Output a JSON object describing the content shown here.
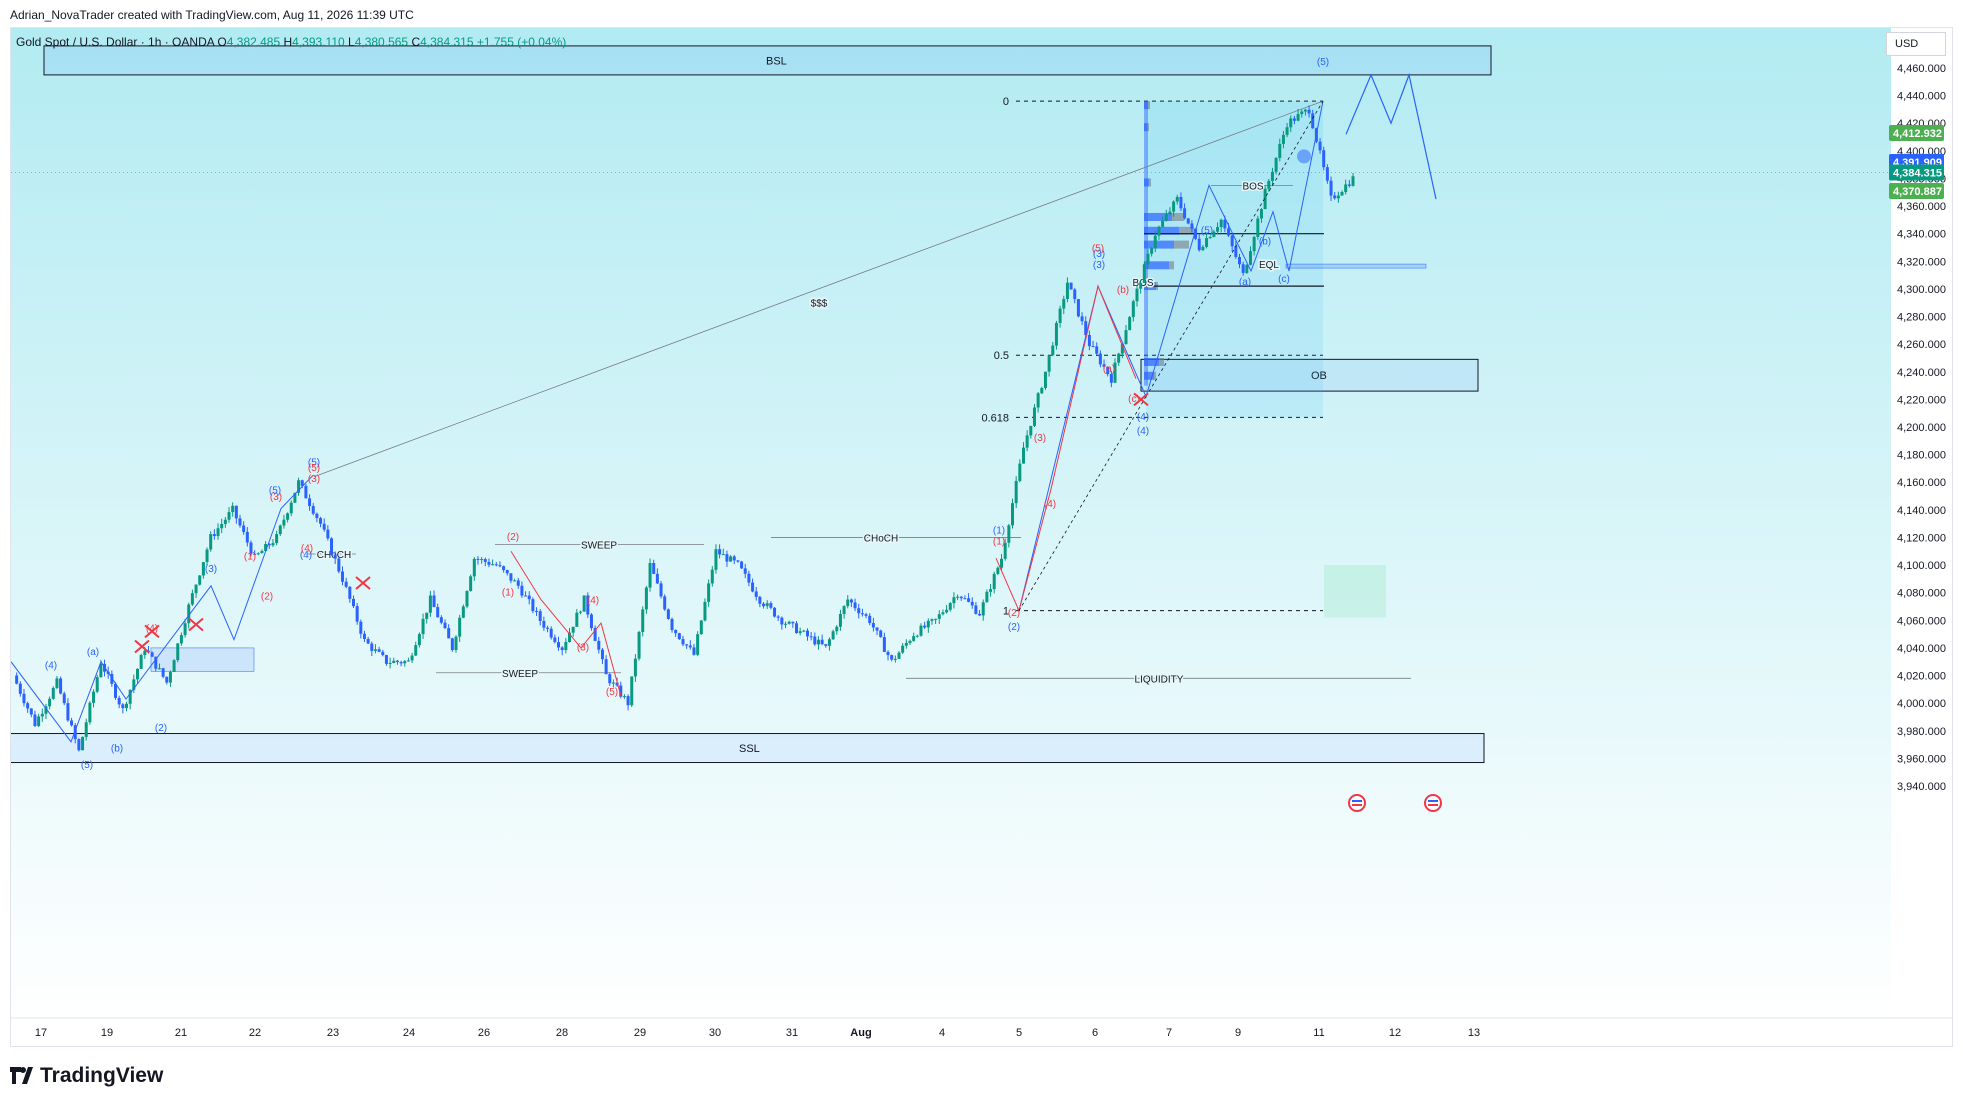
{
  "header": {
    "attribution": "Adrian_NovaTrader created with TradingView.com, Aug 11, 2026 11:39 UTC"
  },
  "symbol": {
    "name": "Gold Spot / U.S. Dollar · 1h · OANDA",
    "o_label": "O",
    "o": "4,382.485",
    "h_label": "H",
    "h": "4,393.110",
    "l_label": "L",
    "l": "4,380.565",
    "c_label": "C",
    "c": "4,384.315",
    "change": "+1.755 (+0.04%)"
  },
  "currency": "USD",
  "footer": {
    "brand": "TradingView"
  },
  "colors": {
    "up": "#089981",
    "down": "#2962ff",
    "blue_wave": "#2962ff",
    "red_wave": "#f23645",
    "bg_top": "#b2ebf2",
    "bg_bottom": "#ffffff"
  },
  "chart_data": {
    "type": "candlestick",
    "ylim": [
      3930,
      4470
    ],
    "y_ticks": [
      "4,460.000",
      "4,440.000",
      "4,420.000",
      "4,400.000",
      "4,380.000",
      "4,360.000",
      "4,340.000",
      "4,320.000",
      "4,300.000",
      "4,280.000",
      "4,260.000",
      "4,240.000",
      "4,220.000",
      "4,200.000",
      "4,180.000",
      "4,160.000",
      "4,140.000",
      "4,120.000",
      "4,100.000",
      "4,080.000",
      "4,060.000",
      "4,040.000",
      "4,020.000",
      "4,000.000",
      "3,980.000",
      "3,960.000",
      "3,940.000"
    ],
    "x_ticks": [
      "17",
      "19",
      "21",
      "22",
      "23",
      "24",
      "26",
      "28",
      "29",
      "30",
      "31",
      "Aug",
      "4",
      "5",
      "6",
      "7",
      "9",
      "11",
      "12",
      "13"
    ],
    "price_labels": [
      {
        "text": "4,412.932",
        "value": 4412.932,
        "color": "#4caf50"
      },
      {
        "text": "4,391.909",
        "value": 4391.909,
        "color": "#2962ff"
      },
      {
        "text": "4,384.315",
        "value": 4384.315,
        "color": "#089981"
      },
      {
        "text": "4,370.887",
        "value": 4370.887,
        "color": "#4caf50"
      }
    ],
    "zones": [
      {
        "label": "BSL",
        "from": 4455,
        "to": 4476
      },
      {
        "label": "SSL",
        "from": 3957,
        "to": 3978
      },
      {
        "label": "OB",
        "from": 4226,
        "to": 4249
      }
    ],
    "fib_levels": [
      {
        "label": "0",
        "value": 4436
      },
      {
        "label": "0.5",
        "value": 4252
      },
      {
        "label": "0.618",
        "value": 4207
      },
      {
        "label": "1",
        "value": 4067
      }
    ],
    "annotations": [
      "BOS",
      "BOS",
      "EQL",
      "$$$",
      "CHoCH",
      "CHoCH",
      "SWEEP",
      "SWEEP",
      "LIQUIDITY"
    ],
    "wave_labels_blue": [
      "(4)",
      "(a)",
      "(3)",
      "(b)",
      "(5)",
      "(2)",
      "(4)",
      "(3)",
      "(5)",
      "(5)",
      "(4)",
      "(1)",
      "(2)",
      "(3)",
      "(4)",
      "(5)",
      "(a)",
      "(b)",
      "(c)",
      "(5)"
    ],
    "wave_labels_red": [
      "(4)",
      "(1)",
      "(2)",
      "(3)",
      "(3)",
      "(5)",
      "(4)",
      "(2)",
      "(1)",
      "(3)",
      "(4)",
      "(5)",
      "(1)",
      "(2)",
      "(3)",
      "(4)",
      "(5)",
      "(b)",
      "(a)",
      "(c)"
    ],
    "series": [
      {
        "name": "XAUUSD",
        "ohlc_anchors": [
          [
            0,
            4020
          ],
          [
            1,
            3985
          ],
          [
            2,
            4015
          ],
          [
            3,
            3965
          ],
          [
            4,
            4030
          ],
          [
            5,
            3995
          ],
          [
            6,
            4040
          ],
          [
            7,
            4015
          ],
          [
            8,
            4070
          ],
          [
            9,
            4120
          ],
          [
            10,
            4140
          ],
          [
            11,
            4105
          ],
          [
            12,
            4120
          ],
          [
            13,
            4160
          ],
          [
            14,
            4130
          ],
          [
            15,
            4090
          ],
          [
            16,
            4045
          ],
          [
            17,
            4030
          ],
          [
            18,
            4030
          ],
          [
            19,
            4075
          ],
          [
            20,
            4040
          ],
          [
            21,
            4105
          ],
          [
            22,
            4100
          ],
          [
            23,
            4085
          ],
          [
            24,
            4060
          ],
          [
            25,
            4040
          ],
          [
            26,
            4075
          ],
          [
            27,
            4020
          ],
          [
            28,
            4000
          ],
          [
            29,
            4100
          ],
          [
            30,
            4055
          ],
          [
            31,
            4035
          ],
          [
            32,
            4110
          ],
          [
            33,
            4100
          ],
          [
            34,
            4075
          ],
          [
            35,
            4060
          ],
          [
            36,
            4050
          ],
          [
            37,
            4040
          ],
          [
            38,
            4075
          ],
          [
            39,
            4060
          ],
          [
            40,
            4030
          ],
          [
            41,
            4050
          ],
          [
            42,
            4060
          ],
          [
            43,
            4080
          ],
          [
            44,
            4065
          ],
          [
            45,
            4105
          ],
          [
            46,
            4185
          ],
          [
            47,
            4240
          ],
          [
            48,
            4305
          ],
          [
            49,
            4260
          ],
          [
            50,
            4235
          ],
          [
            51,
            4290
          ],
          [
            52,
            4340
          ],
          [
            53,
            4365
          ],
          [
            54,
            4330
          ],
          [
            55,
            4350
          ],
          [
            56,
            4310
          ],
          [
            57,
            4370
          ],
          [
            58,
            4420
          ],
          [
            59,
            4430
          ],
          [
            60,
            4365
          ],
          [
            61,
            4380
          ]
        ]
      }
    ],
    "projection": [
      [
        61,
        4412
      ],
      [
        62,
        4455
      ],
      [
        63,
        4420
      ],
      [
        64,
        4455
      ],
      [
        65,
        4365
      ]
    ]
  }
}
